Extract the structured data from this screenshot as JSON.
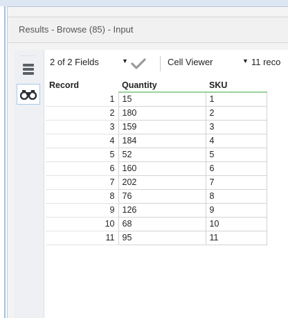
{
  "panel": {
    "title": "Results - Browse (85) - Input"
  },
  "toolbar": {
    "fields_label": "2 of 2 Fields",
    "viewer_label": "Cell Viewer",
    "record_count_label": "11 reco"
  },
  "rail": {
    "icons": [
      "list-icon",
      "binoculars-icon"
    ]
  },
  "table": {
    "headers": [
      "Record",
      "Quantity",
      "SKU"
    ],
    "rows": [
      [
        "1",
        "15",
        "1"
      ],
      [
        "2",
        "180",
        "2"
      ],
      [
        "3",
        "159",
        "3"
      ],
      [
        "4",
        "184",
        "4"
      ],
      [
        "5",
        "52",
        "5"
      ],
      [
        "6",
        "160",
        "6"
      ],
      [
        "7",
        "202",
        "7"
      ],
      [
        "8",
        "76",
        "8"
      ],
      [
        "9",
        "126",
        "9"
      ],
      [
        "10",
        "68",
        "10"
      ],
      [
        "11",
        "95",
        "11"
      ]
    ]
  },
  "colors": {
    "accent_blue": "#5b86c5",
    "header_underline": "#9ad29a",
    "check_gray": "#9a9a9a"
  }
}
